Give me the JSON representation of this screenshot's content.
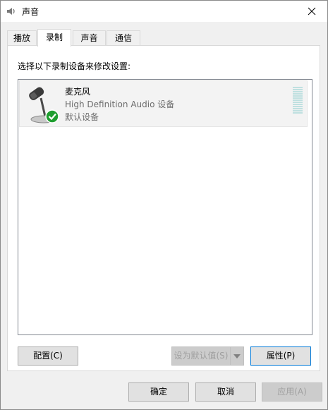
{
  "window": {
    "title": "声音"
  },
  "tabs": [
    {
      "label": "播放",
      "active": false
    },
    {
      "label": "录制",
      "active": true
    },
    {
      "label": "声音",
      "active": false
    },
    {
      "label": "通信",
      "active": false
    }
  ],
  "panel": {
    "instruction": "选择以下录制设备来修改设置:",
    "devices": [
      {
        "name": "麦克风",
        "description": "High Definition Audio 设备",
        "status": "默认设备",
        "icon": "microphone-icon",
        "default_badge": "check-icon"
      }
    ],
    "buttons": {
      "configure": "配置(C)",
      "set_default": "设为默认值(S)",
      "properties": "属性(P)"
    }
  },
  "footer": {
    "ok": "确定",
    "cancel": "取消",
    "apply": "应用(A)"
  },
  "colors": {
    "accent": "#0078d7",
    "check_green": "#1e9e2f",
    "meter": "#bfe0e0"
  }
}
